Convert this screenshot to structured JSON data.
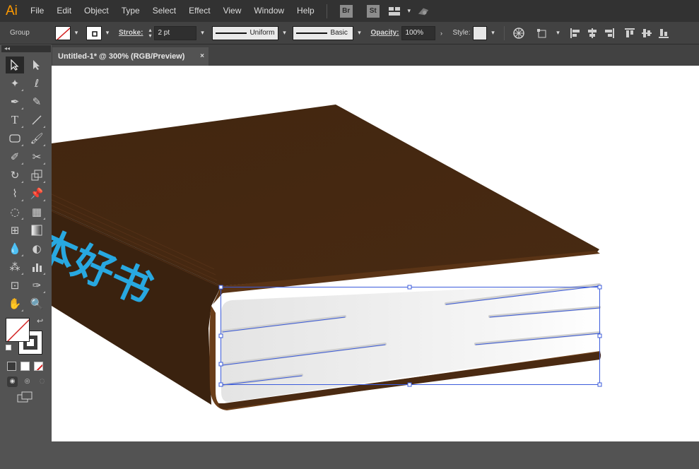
{
  "app": {
    "logo": "Ai"
  },
  "menu": [
    "File",
    "Edit",
    "Object",
    "Type",
    "Select",
    "Effect",
    "View",
    "Window",
    "Help"
  ],
  "app_icons": [
    "Br",
    "St"
  ],
  "control_bar": {
    "selection_label": "Group",
    "stroke_label": "Stroke:",
    "stroke_weight": "2 pt",
    "variable_width_profile": "Uniform",
    "brush_definition": "Basic",
    "opacity_label": "Opacity:",
    "opacity_value": "100%",
    "style_label": "Style:"
  },
  "document": {
    "tab_title": "Untitled-1* @ 300% (RGB/Preview)",
    "close_symbol": "×"
  },
  "artwork": {
    "spine_text": "本好书",
    "colors": {
      "cover": "#442711",
      "cover_edge": "#5a3416",
      "spine": "#3a220f",
      "title_text": "#28a8e0",
      "pages": "#eeeeee",
      "selection": "#3b5bdb"
    }
  },
  "toolbox": {
    "collapse_symbol": "◂◂"
  },
  "colors": {
    "accent_logo": "#ff9a00",
    "menubar": "#323232",
    "controlbar": "#424242",
    "panel": "#535353"
  }
}
